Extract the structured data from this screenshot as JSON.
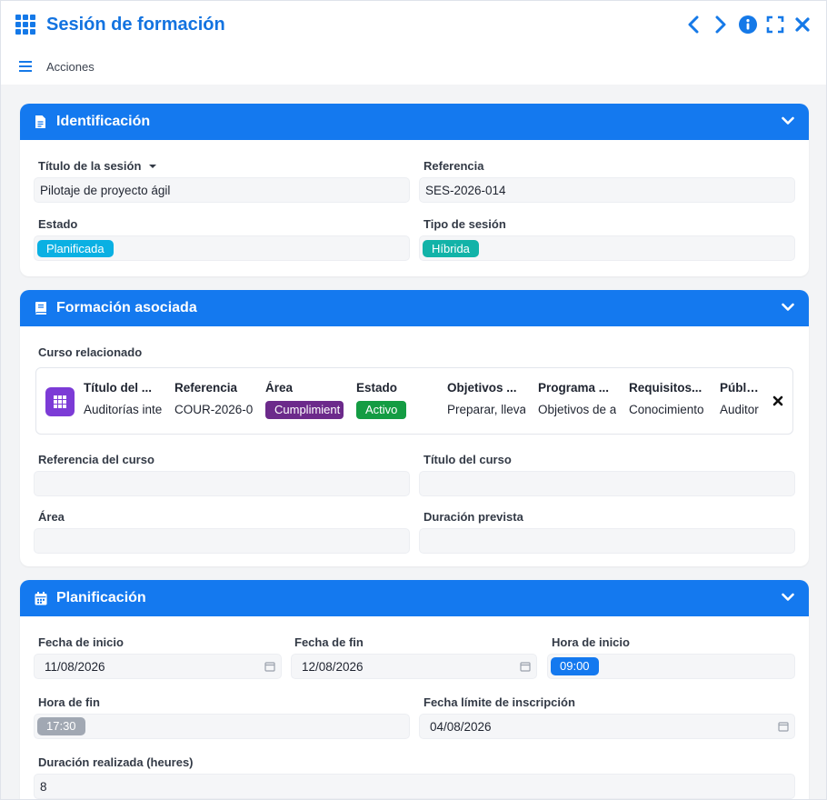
{
  "window": {
    "title": "Sesión de formación"
  },
  "toolbar": {
    "actions_label": "Acciones"
  },
  "colors": {
    "brand": "#1479ef",
    "planned": "#0ab0e3",
    "hybrid": "#12b3a8",
    "compliance": "#6c2a8b",
    "active": "#149c43",
    "time_start": "#1479ef",
    "time_end": "#a1a8b3"
  },
  "identificacion": {
    "header": "Identificación",
    "titulo_label": "Título de la sesión",
    "titulo_value": "Pilotaje de proyecto ágil",
    "referencia_label": "Referencia",
    "referencia_value": "SES-2026-014",
    "estado_label": "Estado",
    "estado_value": "Planificada",
    "tipo_label": "Tipo de sesión",
    "tipo_value": "Híbrida"
  },
  "formacion": {
    "header": "Formación asociada",
    "curso_label": "Curso relacionado",
    "curso_columns": [
      {
        "header": "Título del ...",
        "value": "Auditorías inte"
      },
      {
        "header": "Referencia",
        "value": "COUR-2026-0"
      },
      {
        "header": "Área",
        "value": "Cumplimient"
      },
      {
        "header": "Estado",
        "value": "Activo"
      },
      {
        "header": "Objetivos ...",
        "value": "Preparar, lleva"
      },
      {
        "header": "Programa ...",
        "value": "Objetivos de a"
      },
      {
        "header": "Requisitos...",
        "value": "Conocimiento"
      },
      {
        "header": "Público",
        "value": "Auditor"
      }
    ],
    "ref_curso_label": "Referencia del curso",
    "ref_curso_value": "",
    "titulo_curso_label": "Título del curso",
    "titulo_curso_value": "",
    "area_label": "Área",
    "area_value": "",
    "duracion_prevista_label": "Duración prevista",
    "duracion_prevista_value": ""
  },
  "planificacion": {
    "header": "Planificación",
    "fecha_inicio_label": "Fecha de inicio",
    "fecha_inicio_value": "11/08/2026",
    "fecha_fin_label": "Fecha de fin",
    "fecha_fin_value": "12/08/2026",
    "hora_inicio_label": "Hora de inicio",
    "hora_inicio_value": "09:00",
    "hora_fin_label": "Hora de fin",
    "hora_fin_value": "17:30",
    "fecha_limite_label": "Fecha límite de inscripción",
    "fecha_limite_value": "04/08/2026",
    "duracion_label": "Duración realizada (heures)",
    "duracion_value": "8"
  }
}
